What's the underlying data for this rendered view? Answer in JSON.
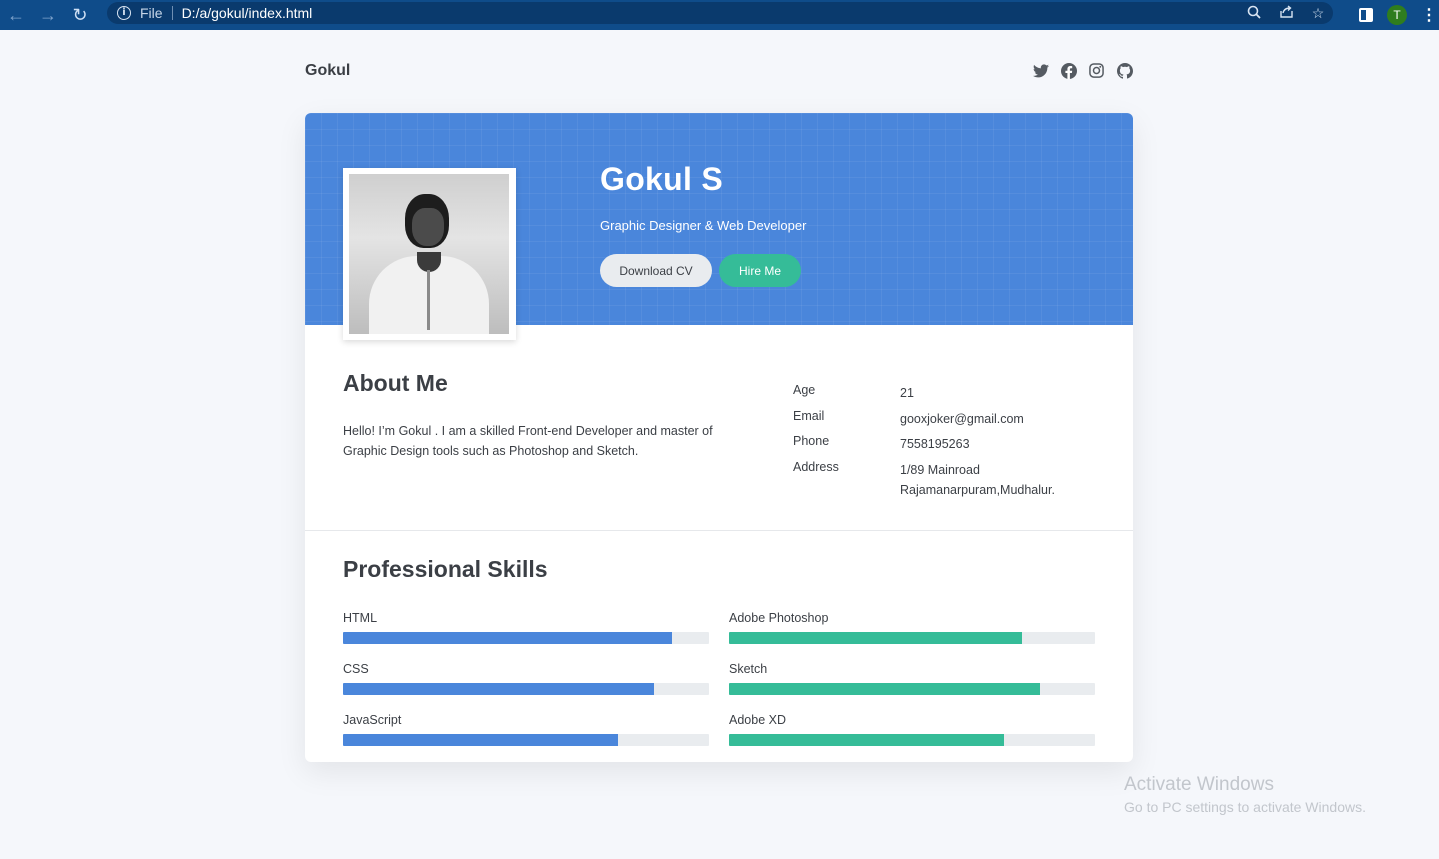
{
  "browser": {
    "file_label": "File",
    "url": "D:/a/gokul/index.html",
    "profile_initial": "T"
  },
  "header": {
    "site_name": "Gokul",
    "social_icons": [
      "twitter-icon",
      "facebook-icon",
      "instagram-icon",
      "github-icon"
    ]
  },
  "hero": {
    "name": "Gokul S",
    "title": "Graphic Designer & Web Developer",
    "download_cv_label": "Download CV",
    "hire_me_label": "Hire Me"
  },
  "about": {
    "heading": "About Me",
    "text": "Hello! I’m Gokul . I am a skilled Front-end Developer and master of Graphic Design tools such as Photoshop and Sketch.",
    "info": [
      {
        "key": "Age",
        "value": "21"
      },
      {
        "key": "Email",
        "value": "gooxjoker@gmail.com"
      },
      {
        "key": "Phone",
        "value": "7558195263"
      },
      {
        "key": "Address",
        "value": "1/89 Mainroad Rajamanarpuram,Mudhalur."
      }
    ]
  },
  "skills": {
    "heading": "Professional Skills",
    "left": [
      {
        "name": "HTML",
        "level": 0.9
      },
      {
        "name": "CSS",
        "level": 0.85
      },
      {
        "name": "JavaScript",
        "level": 0.75
      }
    ],
    "right": [
      {
        "name": "Adobe Photoshop",
        "level": 0.8
      },
      {
        "name": "Sketch",
        "level": 0.85
      },
      {
        "name": "Adobe XD",
        "level": 0.75
      }
    ]
  },
  "colors": {
    "primary": "#4a86db",
    "accent": "#35bc98",
    "track": "#e9ecef"
  },
  "watermark": {
    "line1": "Activate Windows",
    "line2": "Go to PC settings to activate Windows."
  }
}
